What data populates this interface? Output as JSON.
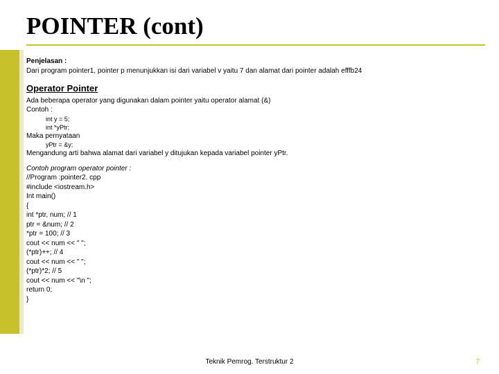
{
  "title": "POINTER (cont)",
  "penjelasan_label": "Penjelasan :",
  "penjelasan_text": "Dari program pointer1, pointer p menunjukkan isi dari variabel v yaitu 7 dan alamat dari pointer adalah efffb24",
  "section_heading": "Operator Pointer",
  "op_line1": "Ada beberapa operator yang digunakan dalam pointer yaitu operator alamat (&)",
  "op_contoh_label": "Contoh :",
  "op_code1": "int y = 5;",
  "op_code2": "int *yPtr;",
  "op_maka": "Maka pernyataan",
  "op_code3": "yPtr = &y;",
  "op_meaning": "Mengandung arti bahwa alamat dari variabel y ditujukan kepada variabel pointer  yPtr.",
  "prog_label": "Contoh program operator pointer :",
  "prog_lines": [
    "//Program :pointer2. cpp",
    "#include <iostream.h>",
    "Int main()",
    "{",
    "int *ptr, num; // 1",
    "ptr = &num; // 2",
    "*ptr = 100; // 3",
    "cout << num << \" \";",
    "(*ptr)++; // 4",
    "cout << num << \" \";",
    "(*ptr)*2; // 5",
    "cout << num << \"\\n \";",
    "return 0;",
    "}"
  ],
  "footer_center": "Teknik Pemrog. Terstruktur 2",
  "footer_page": "7"
}
